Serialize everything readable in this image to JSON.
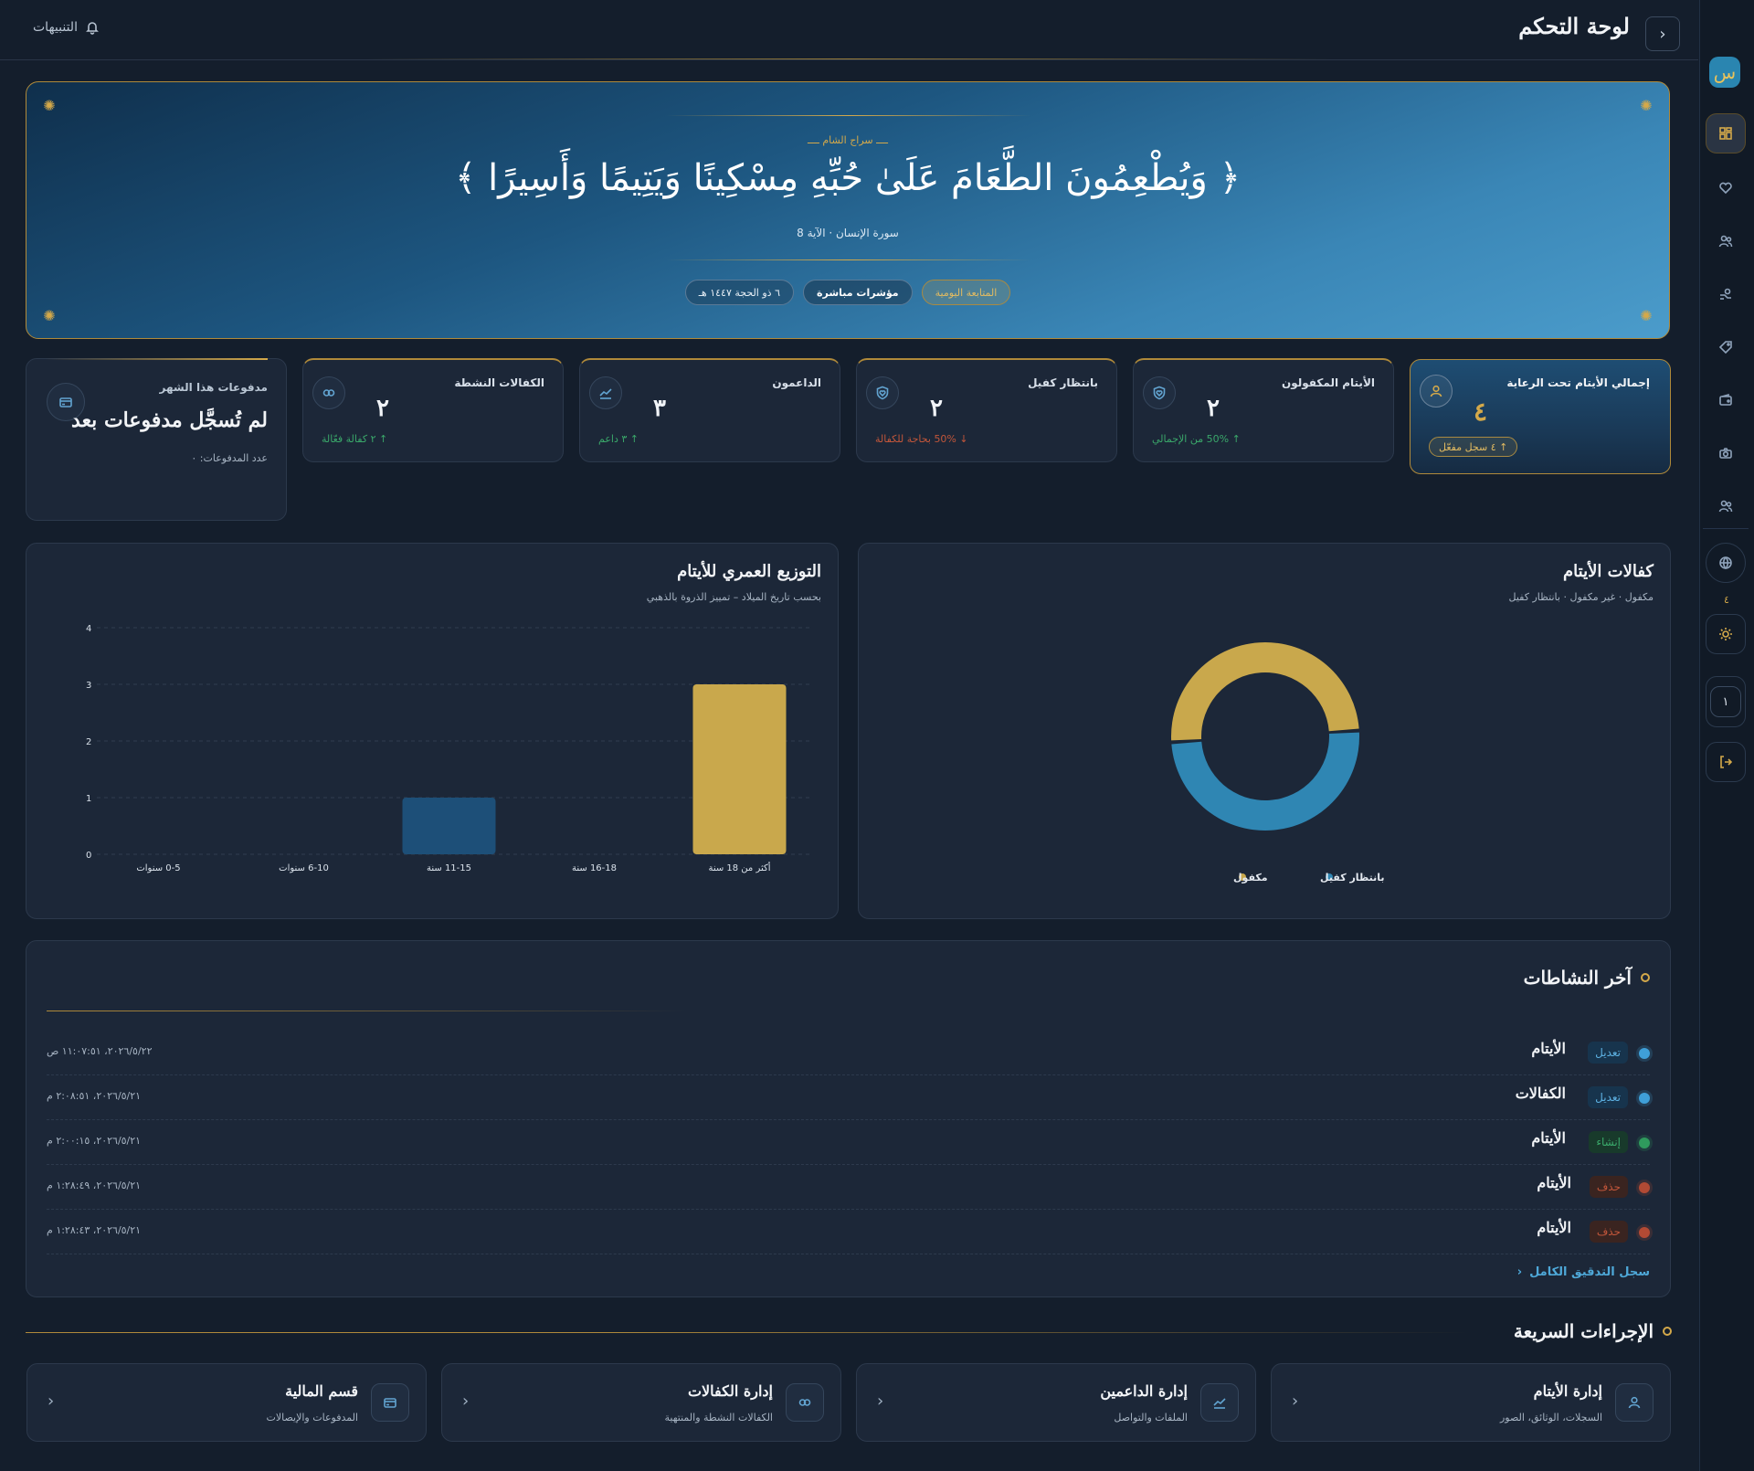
{
  "header": {
    "title": "لوحة التحكم",
    "alerts_label": "التنبيهات"
  },
  "rail": {
    "logo": "س",
    "items": [
      {
        "icon": "dashboard-icon",
        "active": true
      },
      {
        "icon": "heart-hand-icon",
        "active": false
      },
      {
        "icon": "users-icon",
        "active": false
      },
      {
        "icon": "donors-icon",
        "active": false
      },
      {
        "icon": "tag-icon",
        "active": false
      },
      {
        "icon": "wallet-icon",
        "active": false
      },
      {
        "icon": "camera-icon",
        "active": false
      },
      {
        "icon": "team-icon",
        "active": false
      }
    ],
    "globe_count": "٤",
    "page_number": "١"
  },
  "hero": {
    "kicker": "ــــ سراج الشام ــــ",
    "verse": "وَيُطْعِمُونَ الطَّعَامَ عَلَىٰ حُبِّهِ مِسْكِينًا وَيَتِيمًا وَأَسِيرًا",
    "bracket_open": "﴿",
    "bracket_close": "﴾",
    "reference": "سورة الإنسان · الآية 8",
    "pills": [
      "المتابعة اليومية",
      "مؤشرات مباشرة",
      "٦ ذو الحجة ١٤٤٧ هـ"
    ]
  },
  "stats": {
    "total": {
      "title": "إجمالي الأيتام تحت الرعاية",
      "value": "٤",
      "badge": "↑ ٤ سجل مفعّل"
    },
    "sponsored": {
      "title": "الأيتام المكفولون",
      "value": "٢",
      "trend": "↑ 50% من الإجمالي"
    },
    "waiting": {
      "title": "بانتظار كفيل",
      "value": "٢",
      "trend": "↓ 50% بحاجة للكفالة"
    },
    "donors": {
      "title": "الداعمون",
      "value": "٣",
      "trend": "↑ ٣ داعم"
    },
    "active_sponsorships": {
      "title": "الكفالات النشطة",
      "value": "٢",
      "trend": "↑ ٢ كفالة فعّالة"
    },
    "payments": {
      "title": "مدفوعات هذا الشهر",
      "value": "لم تُسجَّل مدفوعات بعد",
      "sub": "عدد المدفوعات: ٠"
    }
  },
  "age_panel": {
    "title": "التوزيع العمري للأيتام",
    "subtitle": "بحسب تاريخ الميلاد – تمييز الذروة بالذهبي"
  },
  "sponsor_panel": {
    "title": "كفالات الأيتام",
    "subtitle": "مكفول · غير مكفول · بانتظار كفيل"
  },
  "chart_data": [
    {
      "type": "bar",
      "title": "التوزيع العمري للأيتام",
      "categories": [
        "أكثر من 18 سنة",
        "16-18 سنة",
        "11-15 سنة",
        "6-10 سنوات",
        "0-5 سنوات"
      ],
      "values": [
        3,
        0,
        1,
        0,
        0
      ],
      "ylim": [
        0,
        4
      ],
      "yticks": [
        "0",
        "1",
        "2",
        "3",
        "4"
      ],
      "grid": true,
      "colors": {
        "peak": "#c9a84c",
        "normal": "#1d4f78"
      }
    },
    {
      "type": "pie",
      "title": "كفالات الأيتام",
      "labels": [
        "مكفول",
        "بانتظار كفيل"
      ],
      "values": [
        2,
        2
      ],
      "colors": [
        "#c9a84c",
        "#2f86b3"
      ],
      "legend": "bottom"
    }
  ],
  "activities": {
    "title": "آخر النشاطات",
    "items": [
      {
        "entity": "الأيتام",
        "action": "تعديل",
        "kind": "edit",
        "time": "٢٠٢٦/٥/٢٢، ١١:٠٧:٥١ ص"
      },
      {
        "entity": "الكفالات",
        "action": "تعديل",
        "kind": "edit",
        "time": "٢٠٢٦/٥/٢١، ٢:٠٨:٥١ م"
      },
      {
        "entity": "الأيتام",
        "action": "إنشاء",
        "kind": "create",
        "time": "٢٠٢٦/٥/٢١، ٢:٠٠:١٥ م"
      },
      {
        "entity": "الأيتام",
        "action": "حذف",
        "kind": "delete",
        "time": "٢٠٢٦/٥/٢١، ١:٢٨:٤٩ م"
      },
      {
        "entity": "الأيتام",
        "action": "حذف",
        "kind": "delete",
        "time": "٢٠٢٦/٥/٢١، ١:٢٨:٤٣ م"
      }
    ],
    "audit_link": "سجل التدقيق الكامل"
  },
  "quick_actions": {
    "title": "الإجراءات السريعة",
    "items": [
      {
        "title": "إدارة الأيتام",
        "sub": "السجلات، الوثائق، الصور",
        "icon": "user-icon"
      },
      {
        "title": "إدارة الداعمين",
        "sub": "الملفات والتواصل",
        "icon": "trend-icon"
      },
      {
        "title": "إدارة الكفالات",
        "sub": "الكفالات النشطة والمنتهية",
        "icon": "link-icon"
      },
      {
        "title": "قسم المالية",
        "sub": "المدفوعات والإيصالات",
        "icon": "card-icon"
      }
    ]
  },
  "colors": {
    "accent_gold": "#d4a94a",
    "accent_blue": "#2f86b3",
    "success": "#3aa86a",
    "danger": "#c2563a"
  }
}
